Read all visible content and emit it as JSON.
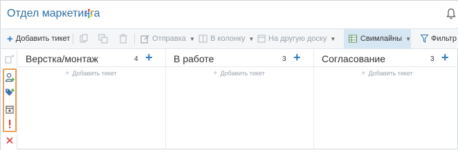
{
  "header": {
    "title": "Отдел маркетинга"
  },
  "toolbar": {
    "add_ticket": "Добавить тикет",
    "send": "Отправка",
    "to_column": "В колонку",
    "to_other_board": "На другую доску",
    "swimlanes": "Свимлайны",
    "filter": "Фильтр"
  },
  "columns": [
    {
      "title": "Верстка/монтаж",
      "count": "4",
      "add_label": "Добавить тикет"
    },
    {
      "title": "В работе",
      "count": "3",
      "add_label": "Добавить тикет"
    },
    {
      "title": "Согласование",
      "count": "3",
      "add_label": "Добавить тикет"
    }
  ],
  "colors": {
    "accent": "#2f7bbf",
    "title": "#2f6fa6",
    "highlight": "#e8a15b",
    "danger": "#e23b3b",
    "tag": "#3b6fb0",
    "tag_plus": "#4caf50"
  },
  "left_strip_icons": [
    "collapse-icon",
    "assign-user-icon",
    "add-tag-icon",
    "calendar-icon",
    "priority-icon",
    "close-icon"
  ]
}
